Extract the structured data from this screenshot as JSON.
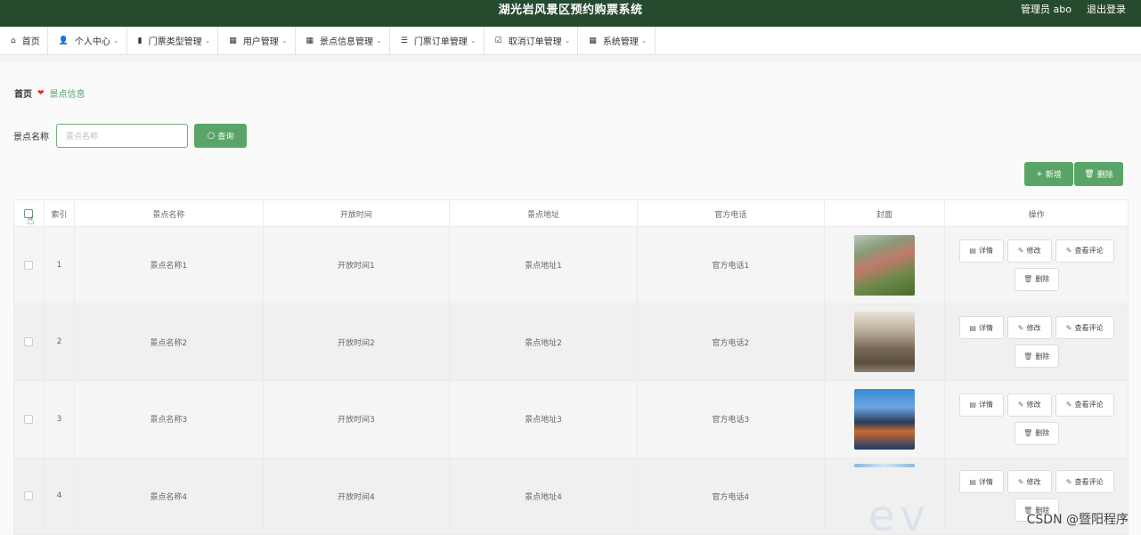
{
  "header": {
    "title": "湖光岩风景区预约购票系统",
    "user_label": "管理员 abo",
    "logout_label": "退出登录"
  },
  "nav": {
    "items": [
      {
        "label": "首页",
        "icon": "home-icon",
        "glyph": "⌂",
        "has_dropdown": false
      },
      {
        "label": "个人中心",
        "icon": "user-icon",
        "glyph": "👤",
        "has_dropdown": true
      },
      {
        "label": "门票类型管理",
        "icon": "clipboard-icon",
        "glyph": "▮",
        "has_dropdown": true
      },
      {
        "label": "用户管理",
        "icon": "grid-icon",
        "glyph": "▦",
        "has_dropdown": true
      },
      {
        "label": "景点信息管理",
        "icon": "grid-icon",
        "glyph": "▦",
        "has_dropdown": true
      },
      {
        "label": "门票订单管理",
        "icon": "list-icon",
        "glyph": "☰",
        "has_dropdown": true
      },
      {
        "label": "取消订单管理",
        "icon": "checkbox-icon",
        "glyph": "☑",
        "has_dropdown": true
      },
      {
        "label": "系统管理",
        "icon": "grid-icon",
        "glyph": "▦",
        "has_dropdown": true
      }
    ]
  },
  "breadcrumb": {
    "home": "首页",
    "current": "景点信息"
  },
  "search": {
    "label": "景点名称",
    "placeholder": "景点名称",
    "button": "查询"
  },
  "actions": {
    "add": "新增",
    "delete": "删除"
  },
  "table": {
    "columns": [
      "索引",
      "景点名称",
      "开放时间",
      "景点地址",
      "官方电话",
      "封面",
      "操作"
    ],
    "rows": [
      {
        "index": "1",
        "name": "景点名称1",
        "time": "开放时间1",
        "addr": "景点地址1",
        "tel": "官方电话1"
      },
      {
        "index": "2",
        "name": "景点名称2",
        "time": "开放时间2",
        "addr": "景点地址2",
        "tel": "官方电话2"
      },
      {
        "index": "3",
        "name": "景点名称3",
        "time": "开放时间3",
        "addr": "景点地址3",
        "tel": "官方电话3"
      },
      {
        "index": "4",
        "name": "景点名称4",
        "time": "开放时间4",
        "addr": "景点地址4",
        "tel": "官方电话4"
      }
    ],
    "row_actions": {
      "detail": "详情",
      "edit": "修改",
      "review": "查看评论",
      "delete": "删除"
    }
  },
  "watermark": "CSDN @暨阳程序",
  "colors": {
    "header_bg": "#264a2e",
    "accent": "#5aa468",
    "heart": "#e0322f"
  }
}
